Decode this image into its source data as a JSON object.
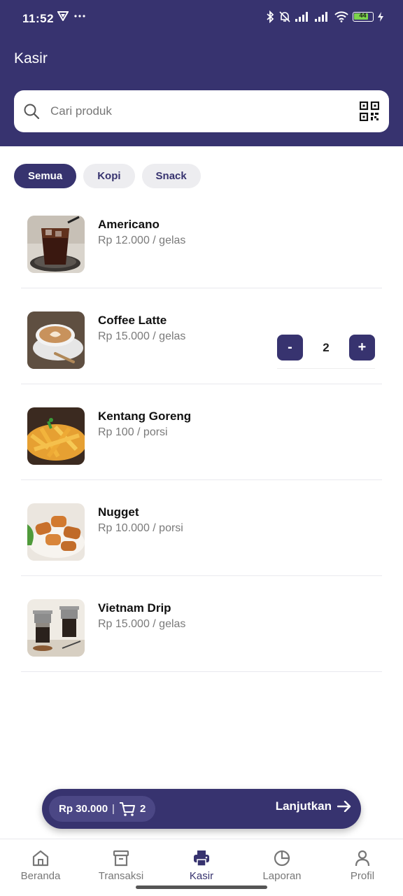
{
  "status_bar": {
    "time": "11:52",
    "battery": "44"
  },
  "header": {
    "title": "Kasir"
  },
  "search": {
    "placeholder": "Cari produk",
    "value": ""
  },
  "categories": [
    {
      "label": "Semua",
      "active": true
    },
    {
      "label": "Kopi",
      "active": false
    },
    {
      "label": "Snack",
      "active": false
    }
  ],
  "products": [
    {
      "name": "Americano",
      "price": "Rp 12.000 / gelas",
      "image": "iced-coffee"
    },
    {
      "name": "Coffee Latte",
      "price": "Rp 15.000 / gelas",
      "image": "latte-cup"
    },
    {
      "name": "Kentang Goreng",
      "price": "Rp 100 / porsi",
      "image": "french-fries"
    },
    {
      "name": "Nugget",
      "price": "Rp 10.000 / porsi",
      "image": "nuggets"
    },
    {
      "name": "Vietnam Drip",
      "price": "Rp 15.000 / gelas",
      "image": "vietnam-drip"
    }
  ],
  "quantity_control": {
    "product": "Coffee Latte",
    "minus_label": "-",
    "value": "2",
    "plus_label": "+"
  },
  "cart": {
    "total": "Rp 30.000",
    "separator": "|",
    "count": "2",
    "next_label": "Lanjutkan"
  },
  "bottom_nav": [
    {
      "label": "Beranda",
      "icon": "home-icon",
      "active": false
    },
    {
      "label": "Transaksi",
      "icon": "archive-icon",
      "active": false
    },
    {
      "label": "Kasir",
      "icon": "printer-icon",
      "active": true
    },
    {
      "label": "Laporan",
      "icon": "pie-chart-icon",
      "active": false
    },
    {
      "label": "Profil",
      "icon": "user-icon",
      "active": false
    }
  ],
  "colors": {
    "primary": "#37336f",
    "muted_text": "#7a7a7a",
    "chip_bg": "#ededf0"
  }
}
